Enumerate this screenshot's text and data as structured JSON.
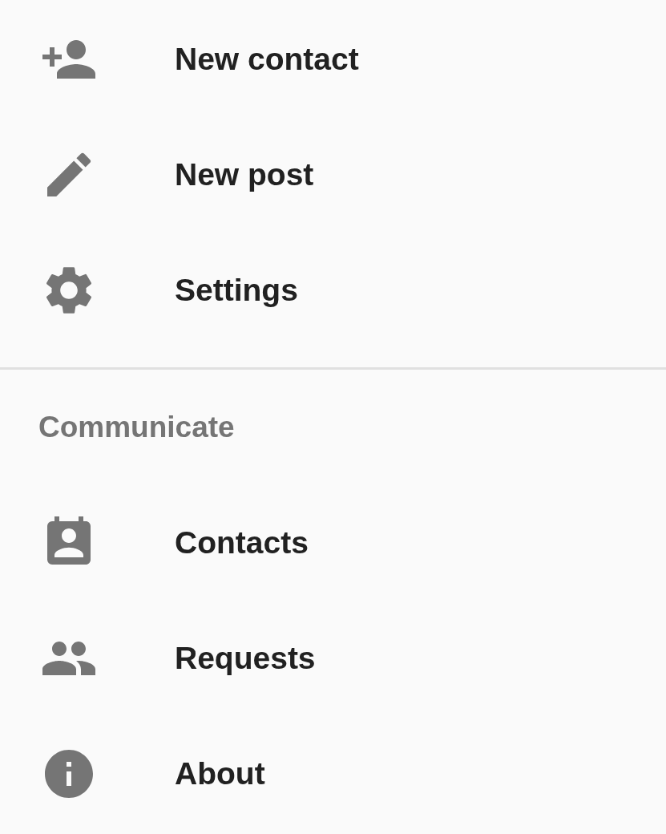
{
  "menu_sections": [
    {
      "items": [
        {
          "label": "New contact"
        },
        {
          "label": "New post"
        },
        {
          "label": "Settings"
        }
      ]
    },
    {
      "header": "Communicate",
      "items": [
        {
          "label": "Contacts"
        },
        {
          "label": "Requests"
        },
        {
          "label": "About"
        }
      ]
    }
  ]
}
